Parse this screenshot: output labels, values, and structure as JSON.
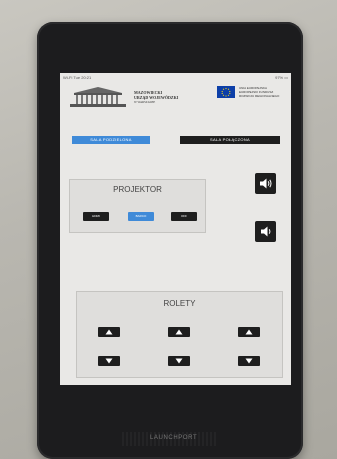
{
  "statusbar": {
    "left": "Wi-Fi  Tue 20:21",
    "right": "97% ▭"
  },
  "header": {
    "org_line1": "MAZOWIECKI",
    "org_line2": "URZĄD WOJEWÓDZKI",
    "org_line3": "W WARSZAWIE",
    "eu_line1": "UNIA EUROPEJSKA",
    "eu_line2": "EUROPEJSKI FUNDUSZ",
    "eu_line3": "ROZWOJU REGIONALNEGO"
  },
  "tabs": {
    "left": "SALA PODZIELONA",
    "right": "SALA POŁĄCZONA"
  },
  "projector": {
    "title": "PROJEKTOR",
    "hdmi": "HDMI",
    "barco": "BARCO",
    "off": "OFF"
  },
  "rolety": {
    "title": "ROLETY"
  },
  "device": {
    "brand": "LAUNCHPORT"
  },
  "colors": {
    "accent": "#3f8ad8",
    "button_dark": "#1e1e1e",
    "screen_bg": "#e9e8e6"
  },
  "icons": {
    "volume_up": "speaker-loud-icon",
    "volume_down": "speaker-quiet-icon",
    "blind_up": "triangle-up-icon",
    "blind_down": "triangle-down-icon"
  }
}
